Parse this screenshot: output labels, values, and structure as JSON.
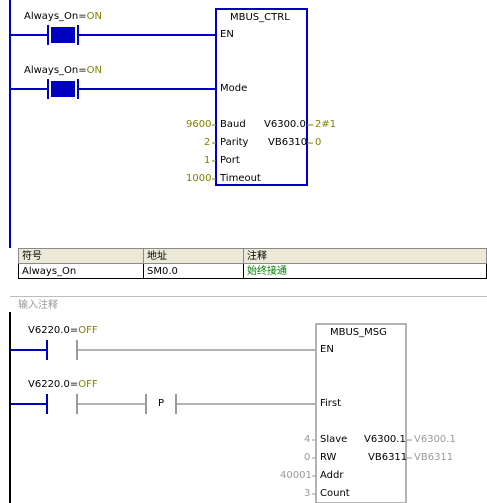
{
  "network1": {
    "contact1": {
      "label": "Always_On=",
      "state": "ON"
    },
    "contact2": {
      "label": "Always_On=",
      "state": "ON"
    },
    "block": {
      "title": "MBUS_CTRL",
      "pins_in": [
        "EN",
        "Mode",
        "Baud",
        "Parity",
        "Port",
        "Timeout"
      ],
      "pins_out": [
        "V6300.0",
        "VB6310"
      ],
      "values_in": {
        "baud": "9600",
        "parity": "2",
        "port": "1",
        "timeout": "1000"
      },
      "values_out": {
        "done": "2#1",
        "error": "0"
      }
    },
    "symbol_table": {
      "headers": [
        "符号",
        "地址",
        "注释"
      ],
      "rows": [
        {
          "symbol": "Always_On",
          "address": "SM0.0",
          "comment": "始终接通"
        }
      ]
    }
  },
  "network2": {
    "comment_placeholder": "输入注释",
    "contact1": {
      "label": "V6220.0=",
      "state": "OFF"
    },
    "contact2": {
      "label": "V6220.0=",
      "state": "OFF"
    },
    "p_contact": "P",
    "block": {
      "title": "MBUS_MSG",
      "pins_in": [
        "EN",
        "First",
        "Slave",
        "RW",
        "Addr",
        "Count"
      ],
      "pins_out": [
        "V6300.1",
        "VB6311"
      ],
      "values_in": {
        "slave": "4",
        "rw": "0",
        "addr": "40001",
        "count": "3"
      },
      "values_out": {
        "done": "V6300.1",
        "error": "VB6311"
      }
    }
  },
  "colors": {
    "block_blue": "#0000c0",
    "value_olive": "#808000",
    "inactive_gray": "#9a9a9a",
    "comment_green": "#008000"
  }
}
